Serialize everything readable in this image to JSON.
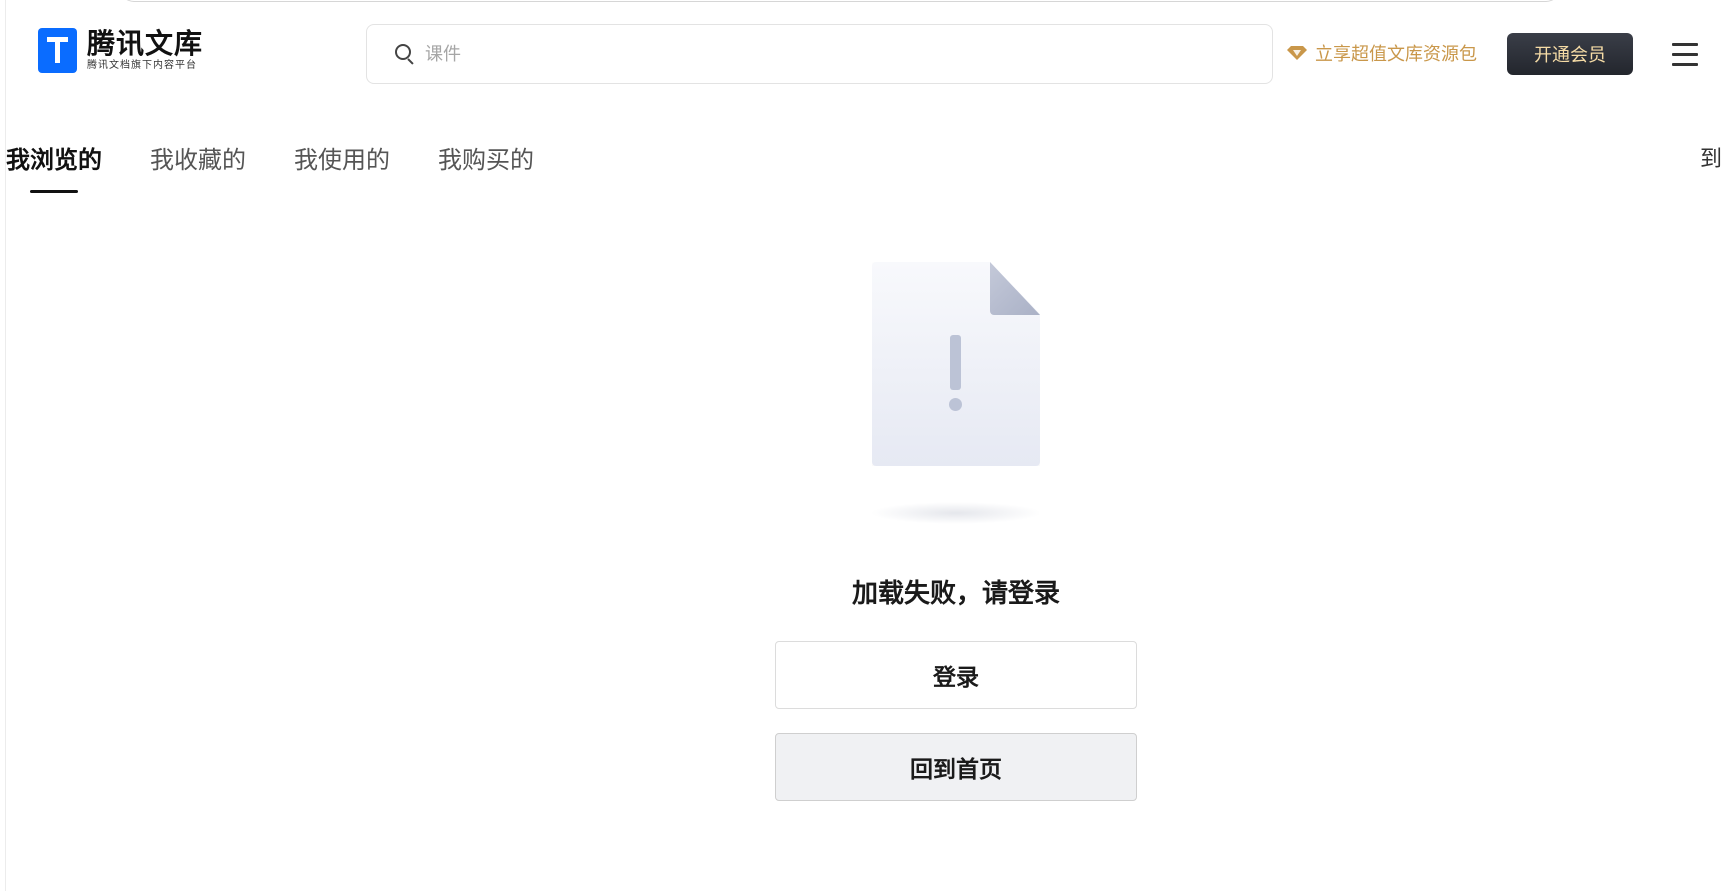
{
  "header": {
    "logo_title": "腾讯文库",
    "logo_subtitle": "腾讯文档旗下内容平台",
    "search_placeholder": "课件",
    "promo_text": "立享超值文库资源包",
    "vip_button_label": "开通会员"
  },
  "tabs": [
    {
      "label": "我浏览的",
      "active": true
    },
    {
      "label": "我收藏的",
      "active": false
    },
    {
      "label": "我使用的",
      "active": false
    },
    {
      "label": "我购买的",
      "active": false
    }
  ],
  "tab_overflow_text": "到",
  "empty_state": {
    "message": "加载失败，请登录",
    "login_button": "登录",
    "home_button": "回到首页"
  },
  "colors": {
    "brand_blue": "#0a6cff",
    "promo_gold": "#c9974a",
    "vip_button_bg": "#2b2e36",
    "vip_button_text": "#f6dca6"
  },
  "icons": {
    "search": "search-icon",
    "promo": "diamond-icon",
    "menu": "hamburger-menu-icon",
    "illustration": "document-error-icon"
  }
}
